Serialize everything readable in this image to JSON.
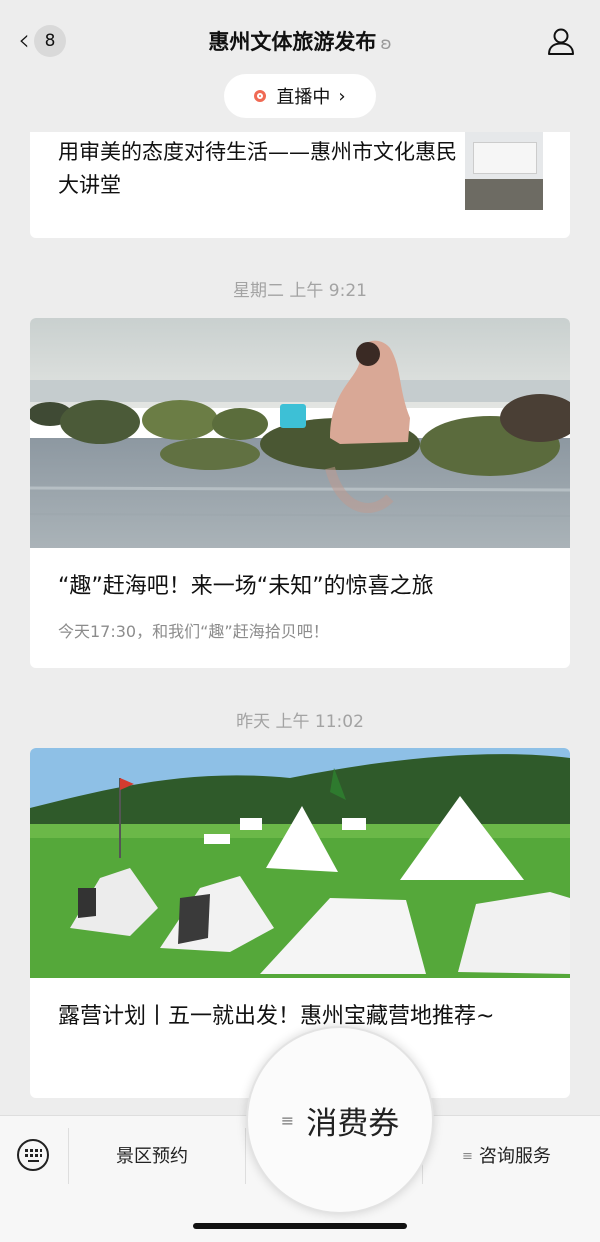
{
  "header": {
    "back_count": "8",
    "title": "惠州文体旅游发布",
    "live_label": "直播中"
  },
  "articles": [
    {
      "title": "用审美的态度对待生活——惠州市文化惠民大讲堂"
    },
    {
      "time": "星期二 上午 9:21",
      "title": "“趣”赶海吧！来一场“未知”的惊喜之旅",
      "subtitle": "今天17:30，和我们“趣”赶海拾贝吧！"
    },
    {
      "time": "昨天 上午 11:02",
      "title": "露营计划丨五一就出发！惠州宝藏营地推荐~"
    }
  ],
  "menu": {
    "items": [
      "景区预约",
      "消费券",
      "咨询服务"
    ]
  },
  "icons": {
    "back": "chevron-left-icon",
    "profile": "person-icon",
    "keyboard": "keyboard-icon",
    "menu": "menu-lines-icon"
  },
  "colors": {
    "live_dot": "#f06a54",
    "background": "#ededed"
  }
}
